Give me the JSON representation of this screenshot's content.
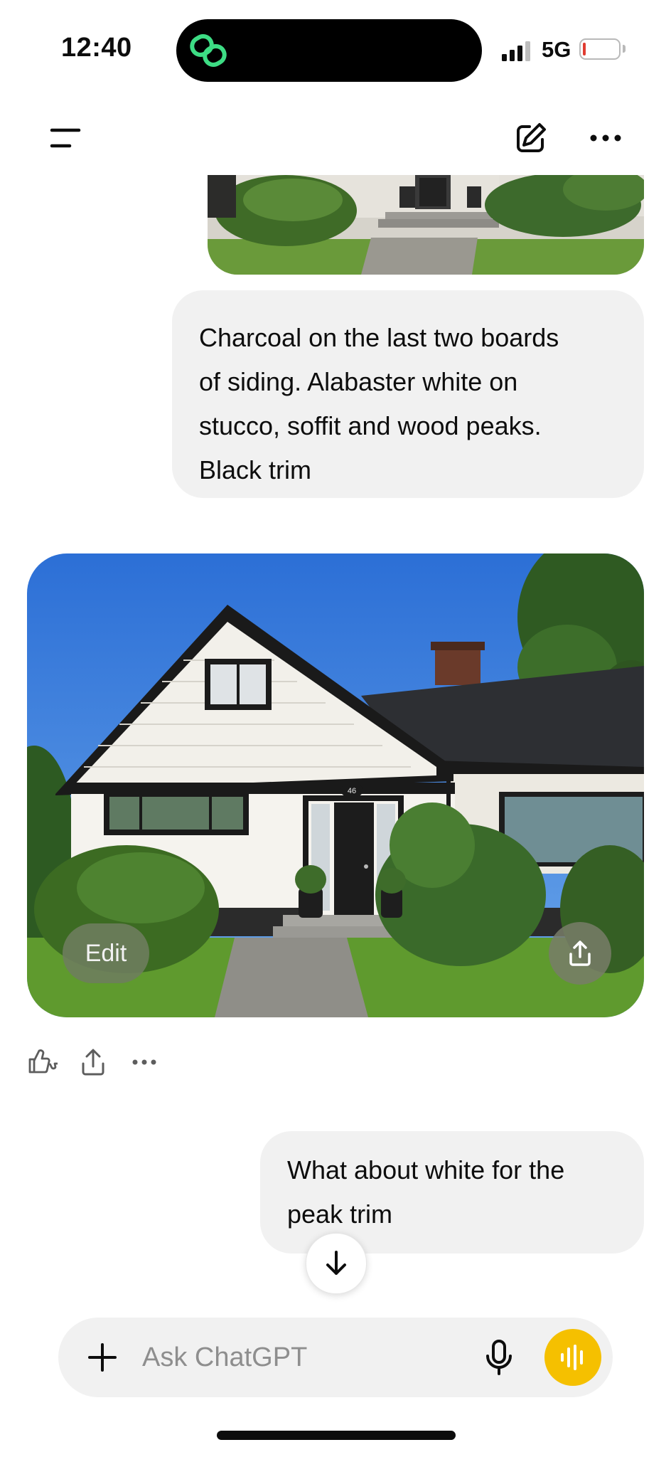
{
  "status_bar": {
    "time": "12:40",
    "network": "5G",
    "battery_level": 0.05,
    "island_icon": "linked-rings-icon",
    "island_icon_color": "#3ddc84"
  },
  "nav": {
    "menu_icon": "menu-icon",
    "new_chat_icon": "compose-icon",
    "more_icon": "more-icon"
  },
  "messages": {
    "user_message_1": {
      "lines": [
        "Charcoal on the last two boards",
        "of siding. Alabaster white on",
        "stucco, soffit and wood peaks.",
        "Black trim"
      ]
    },
    "generated_image": {
      "house_number": "46",
      "edit_label": "Edit",
      "share_icon": "share-icon"
    },
    "response_actions": {
      "thumbs_icon": "thumbs-icon",
      "share_icon": "share-icon",
      "more_icon": "more-icon"
    },
    "user_message_2": {
      "lines": [
        "What about white for the",
        "peak trim"
      ]
    }
  },
  "composer": {
    "placeholder": "Ask ChatGPT",
    "accent": "#f5c000"
  }
}
